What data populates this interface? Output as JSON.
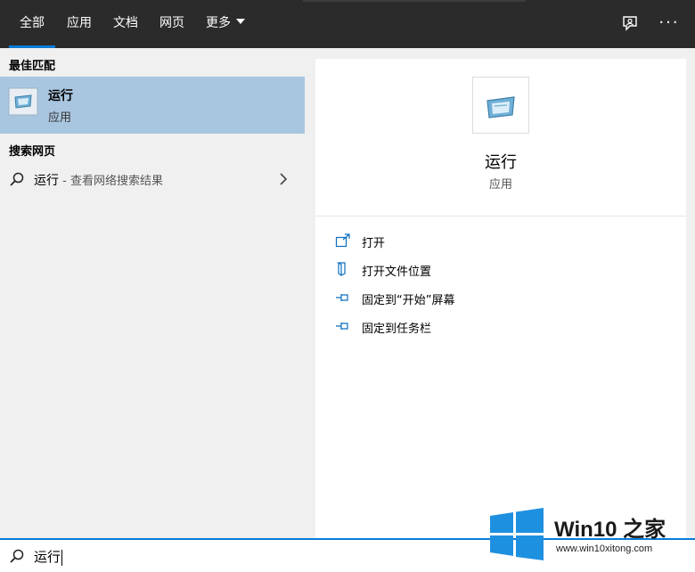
{
  "tabs": [
    {
      "label": "全部",
      "active": true
    },
    {
      "label": "应用",
      "active": false
    },
    {
      "label": "文档",
      "active": false
    },
    {
      "label": "网页",
      "active": false
    },
    {
      "label": "更多",
      "active": false
    }
  ],
  "toolbar": {
    "feedback_icon": "feedback-icon",
    "more_icon": "ellipsis-icon"
  },
  "left": {
    "best_match_title": "最佳匹配",
    "best_match": {
      "name": "运行",
      "type": "应用",
      "icon": "run-app-icon"
    },
    "web_search_title": "搜索网页",
    "web_result": {
      "query": "运行",
      "hint": " - 查看网络搜索结果"
    }
  },
  "preview": {
    "name": "运行",
    "type": "应用",
    "actions": [
      {
        "label": "打开",
        "icon": "open-icon"
      },
      {
        "label": "打开文件位置",
        "icon": "file-location-icon"
      },
      {
        "label": "固定到“开始”屏幕",
        "icon": "pin-icon"
      },
      {
        "label": "固定到任务栏",
        "icon": "pin-icon"
      }
    ]
  },
  "search": {
    "value": "运行"
  },
  "watermark": {
    "brand": "Win10 之家",
    "site": "www.win10xitong.com"
  },
  "colors": {
    "accent": "#0a7bd7",
    "selected": "#a9c6e0",
    "topbar": "#2b2b2b"
  }
}
